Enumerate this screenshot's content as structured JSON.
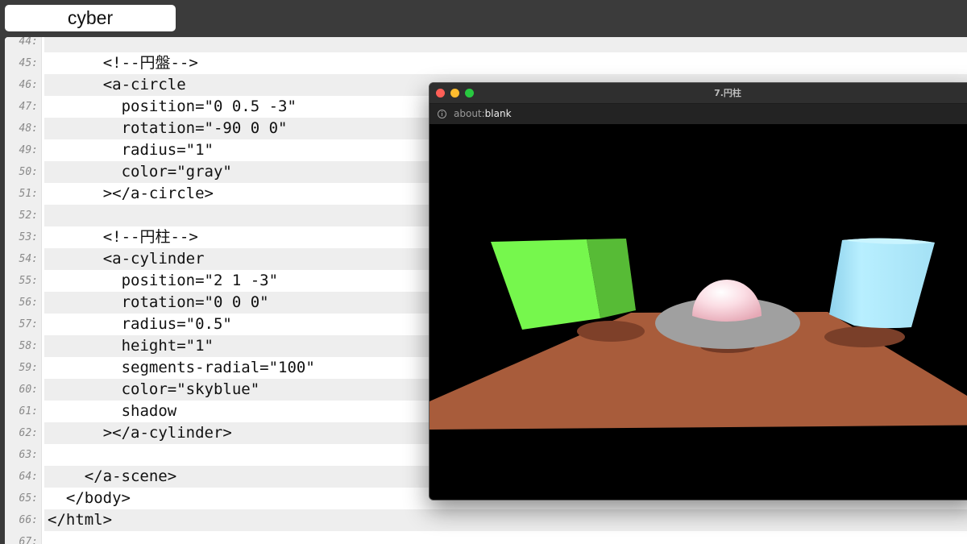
{
  "tab": {
    "label": "cyber"
  },
  "editor": {
    "lines": [
      {
        "num": "44:",
        "text": ""
      },
      {
        "num": "45:",
        "text": "      <!--円盤-->"
      },
      {
        "num": "46:",
        "text": "      <a-circle"
      },
      {
        "num": "47:",
        "text": "        position=\"0 0.5 -3\""
      },
      {
        "num": "48:",
        "text": "        rotation=\"-90 0 0\""
      },
      {
        "num": "49:",
        "text": "        radius=\"1\""
      },
      {
        "num": "50:",
        "text": "        color=\"gray\""
      },
      {
        "num": "51:",
        "text": "      ></a-circle>"
      },
      {
        "num": "52:",
        "text": ""
      },
      {
        "num": "53:",
        "text": "      <!--円柱-->"
      },
      {
        "num": "54:",
        "text": "      <a-cylinder"
      },
      {
        "num": "55:",
        "text": "        position=\"2 1 -3\""
      },
      {
        "num": "56:",
        "text": "        rotation=\"0 0 0\""
      },
      {
        "num": "57:",
        "text": "        radius=\"0.5\""
      },
      {
        "num": "58:",
        "text": "        height=\"1\""
      },
      {
        "num": "59:",
        "text": "        segments-radial=\"100\""
      },
      {
        "num": "60:",
        "text": "        color=\"skyblue\""
      },
      {
        "num": "61:",
        "text": "        shadow"
      },
      {
        "num": "62:",
        "text": "      ></a-cylinder>"
      },
      {
        "num": "63:",
        "text": ""
      },
      {
        "num": "64:",
        "text": "    </a-scene>"
      },
      {
        "num": "65:",
        "text": "  </body>"
      },
      {
        "num": "66:",
        "text": "</html>"
      },
      {
        "num": "67:",
        "text": ""
      }
    ]
  },
  "browser": {
    "window_title": "7.円柱",
    "url_scheme": "about:",
    "url_rest": "blank"
  },
  "scene": {
    "objects": [
      {
        "name": "box",
        "color": "#76f74d"
      },
      {
        "name": "sphere",
        "color": "#fbd3dc"
      },
      {
        "name": "circle",
        "color": "#a0a0a0"
      },
      {
        "name": "cylinder",
        "color": "#a9e7f7"
      },
      {
        "name": "plane",
        "color": "#a85c3b"
      }
    ]
  }
}
